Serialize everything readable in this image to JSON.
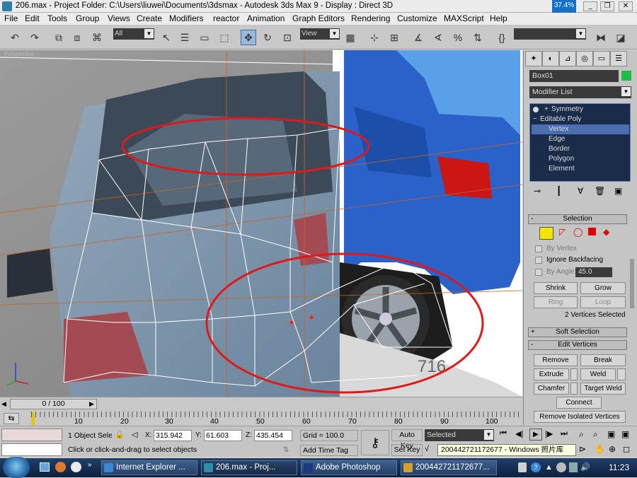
{
  "window": {
    "title": "206.max   - Project Folder: C:\\Users\\liuwei\\Documents\\3dsmax    - Autodesk 3ds Max 9    - Display : Direct 3D",
    "cpu_badge": "37.4%"
  },
  "menu": [
    "File",
    "Edit",
    "Tools",
    "Group",
    "Views",
    "Create",
    "Modifiers",
    "reactor",
    "Animation",
    "Graph Editors",
    "Rendering",
    "Customize",
    "MAXScript",
    "Help"
  ],
  "toolbar": {
    "selection_filter": "All",
    "ref_coord": "View"
  },
  "viewport": {
    "label": "Perspective",
    "image_text": "716"
  },
  "command_panel": {
    "object_name": "Box01",
    "object_color": "#22bb44",
    "modifier_list": "Modifier List",
    "stack": [
      {
        "label": "Symmetry",
        "prefix": "+"
      },
      {
        "label": "Editable Poly",
        "prefix": "−"
      },
      {
        "label": "Vertex",
        "selected": true
      },
      {
        "label": "Edge"
      },
      {
        "label": "Border"
      },
      {
        "label": "Polygon"
      },
      {
        "label": "Element"
      }
    ],
    "selection": {
      "header": "Selection",
      "by_vertex": "By Vertex",
      "ignore_backfacing": "Ignore Backfacing",
      "by_angle": "By Angle:",
      "angle_value": "45.0",
      "shrink": "Shrink",
      "grow": "Grow",
      "ring": "Ring",
      "loop": "Loop",
      "status": "2 Vertices Selected"
    },
    "soft_selection": "Soft Selection",
    "edit_vertices": {
      "header": "Edit Vertices",
      "remove": "Remove",
      "break": "Break",
      "extrude": "Extrude",
      "weld": "Weld",
      "chamfer": "Chamfer",
      "target_weld": "Target Weld",
      "connect": "Connect",
      "remove_isolated": "Remove Isolated Vertices"
    }
  },
  "timeline": {
    "frame": "0 / 100",
    "ticks": [
      "10",
      "20",
      "30",
      "40",
      "50",
      "60",
      "70",
      "80",
      "90",
      "100"
    ]
  },
  "status": {
    "selected_count": "1 Object Sele",
    "x": "315.942",
    "y": "61.603",
    "z": "435.454",
    "grid": "Grid = 100.0",
    "prompt": "Click or click-and-drag to select objects",
    "add_time_tag": "Add Time Tag",
    "auto_key": "Auto Key",
    "set_key": "Set Key",
    "key_filter": "Selected",
    "tooltip": "200442721172677 - Windows 照片库",
    "axis_x": "X:",
    "axis_y": "Y:",
    "axis_z": "Z:"
  },
  "taskbar": {
    "tasks": [
      {
        "label": "Internet Explorer ...",
        "icon": "#3a86d8"
      },
      {
        "label": "206.max    - Proj...",
        "icon": "#2b8fa8",
        "active": true
      },
      {
        "label": "Adobe Photoshop",
        "icon": "#1d3a80"
      },
      {
        "label": "200442721172677...",
        "icon": "#d8a030"
      }
    ],
    "clock": "11:23"
  }
}
